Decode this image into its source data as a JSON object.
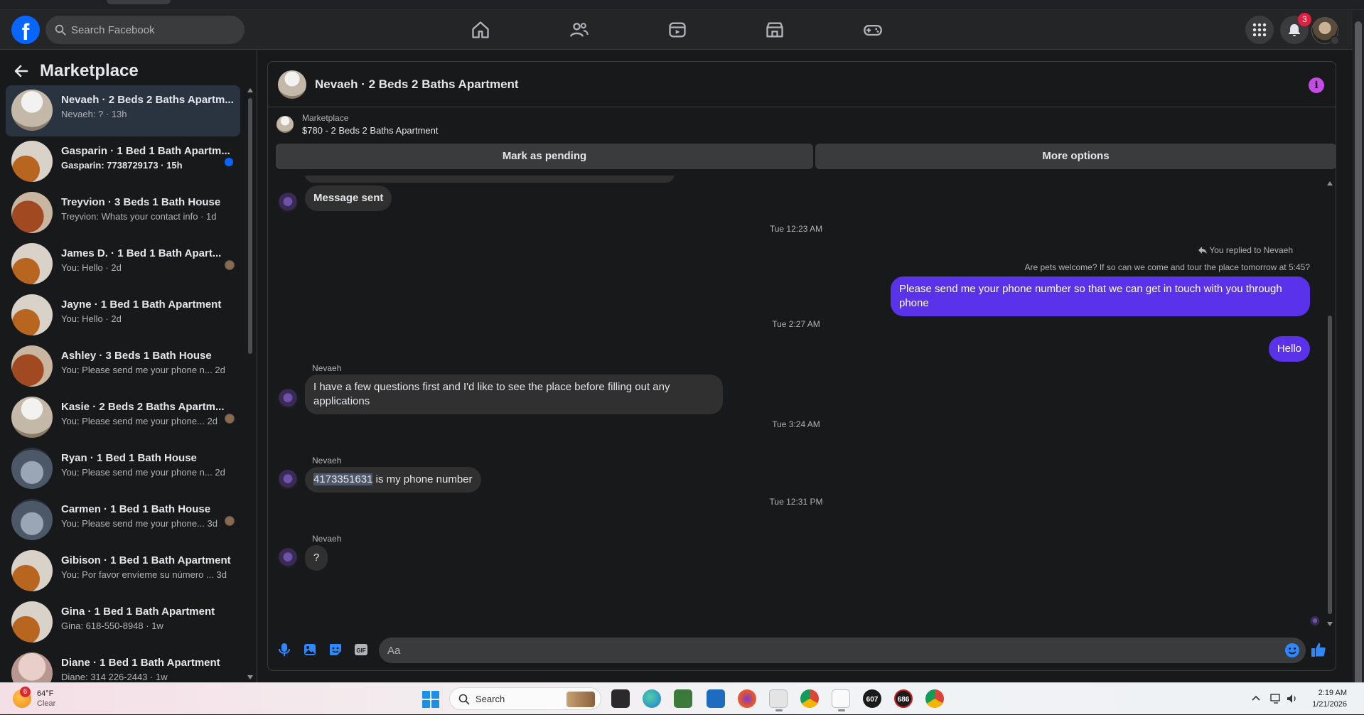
{
  "topnav": {
    "logo_letter": "f",
    "search_placeholder": "Search Facebook",
    "nav_icons": [
      "home-icon",
      "friends-icon",
      "video-icon",
      "marketplace-icon",
      "gaming-icon"
    ],
    "notification_count": "3"
  },
  "sidebar": {
    "title": "Marketplace",
    "conversations": [
      {
        "title": "Nevaeh · 2 Beds 2 Baths Apartm...",
        "preview": "Nevaeh: ? · 13h",
        "active": true,
        "thumb": "t2"
      },
      {
        "title": "Gasparin · 1 Bed 1 Bath Apartm...",
        "preview": "Gasparin: 7738729173 · 15h",
        "unread": true,
        "thumb": "t1"
      },
      {
        "title": "Treyvion · 3 Beds 1 Bath House",
        "preview": "Treyvion: Whats your contact info · 1d",
        "thumb": "t3"
      },
      {
        "title": "James D. · 1 Bed 1 Bath Apart...",
        "preview": "You: Hello · 2d",
        "thumb": "t1"
      },
      {
        "title": "Jayne · 1 Bed 1 Bath Apartment",
        "preview": "You: Hello · 2d",
        "thumb": "t1"
      },
      {
        "title": "Ashley · 3 Beds 1 Bath House",
        "preview": "You: Please send me your phone n...  2d",
        "thumb": "t3"
      },
      {
        "title": "Kasie · 2 Beds 2 Baths Apartm...",
        "preview": "You: Please send me your phone...  2d",
        "thumb": "t2"
      },
      {
        "title": "Ryan · 1 Bed 1 Bath House",
        "preview": "You: Please send me your phone n...  2d",
        "thumb": "t4"
      },
      {
        "title": "Carmen · 1 Bed 1 Bath House",
        "preview": "You: Please send me your phone...  3d",
        "thumb": "t4"
      },
      {
        "title": "Gibison · 1 Bed 1 Bath Apartment",
        "preview": "You: Por favor envíeme su número ...  3d",
        "thumb": "t1"
      },
      {
        "title": "Gina · 1 Bed 1 Bath Apartment",
        "preview": "Gina: 618-550-8948 · 1w",
        "thumb": "t1"
      },
      {
        "title": "Diane · 1 Bed 1 Bath Apartment",
        "preview": "Diane: 314 226-2443 · 1w",
        "thumb": "t5"
      }
    ]
  },
  "chat": {
    "title": "Nevaeh · 2 Beds 2 Baths Apartment",
    "listing_source": "Marketplace",
    "listing_price": "$780 - 2 Beds 2 Baths Apartment",
    "mark_pending_label": "Mark as pending",
    "more_options_label": "More options",
    "messages": {
      "m1": "Message sent",
      "ts1": "Tue 12:23 AM",
      "reply_note": "You replied to Nevaeh",
      "quoted": "Are pets welcome? If so can we come and tour the place tomorrow at 5:45?",
      "m2": "Please send me your phone  number so that we can get in touch with you through phone",
      "ts2": "Tue 2:27 AM",
      "m3": "Hello",
      "sender": "Nevaeh",
      "m4": "I have a few questions first and I'd like to see the place before filling out any applications",
      "ts3": "Tue 3:24 AM",
      "m5_phone": "4173351631",
      "m5_rest": " is my phone number",
      "ts4": "Tue 12:31 PM",
      "m6": "?"
    },
    "composer_placeholder": "Aa"
  },
  "taskbar": {
    "temp": "64°F",
    "condition": "Clear",
    "weather_badge": "6",
    "search_label": "Search",
    "app_badge_1": "607",
    "app_badge_2": "686",
    "time": "2:19 AM",
    "date": "1/21/2026"
  }
}
